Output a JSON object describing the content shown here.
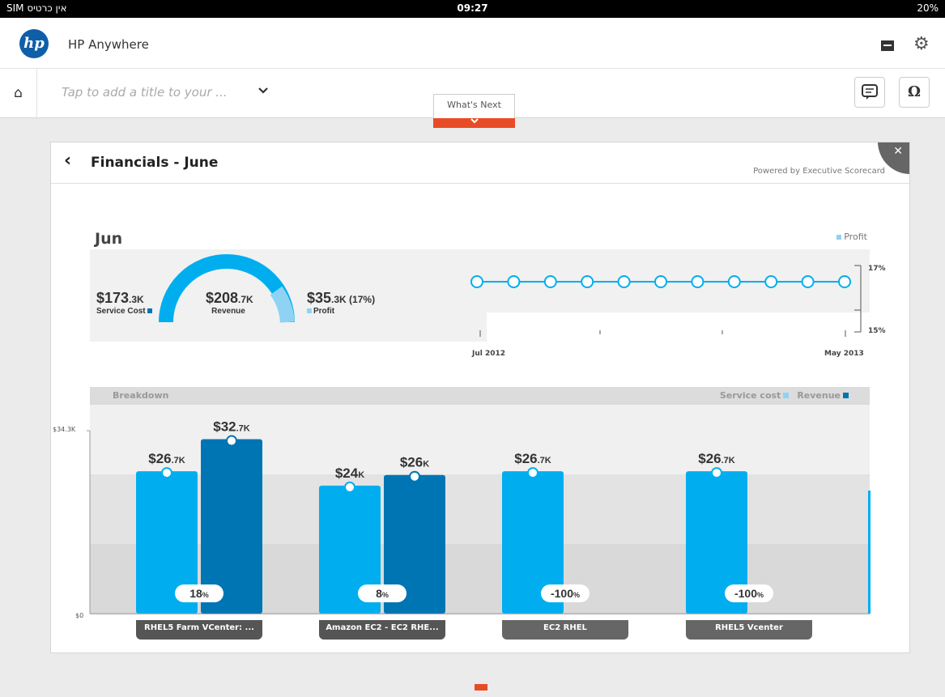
{
  "status_bar": {
    "carrier": "SIM אין כרטיס",
    "time": "09:27",
    "battery": "20%"
  },
  "app": {
    "logo_text": "hp",
    "title": "HP Anywhere"
  },
  "toolbar": {
    "title_placeholder": "Tap to add a title to your ...",
    "whats_next": "What's Next"
  },
  "card": {
    "title": "Financials - June",
    "powered_by": "Powered by Executive Scorecard",
    "close": "✕",
    "month": "Jun",
    "legend_profit": "Profit",
    "kpis": {
      "service_cost": {
        "amount": "$173",
        "unit": ".3K",
        "label": "Service Cost"
      },
      "revenue": {
        "amount": "$208",
        "unit": ".7K",
        "label": "Revenue"
      },
      "profit": {
        "amount": "$35",
        "unit": ".3K (17%)",
        "label": "Profit"
      }
    },
    "trend": {
      "y_top": "17%",
      "y_bottom": "15%",
      "x_start": "Jul 2012",
      "x_end": "May 2013",
      "points": 11
    },
    "breakdown": {
      "label": "Breakdown",
      "legend_service_cost": "Service cost",
      "legend_revenue": "Revenue",
      "y_top": "$34.3K",
      "y_bottom": "$0",
      "groups": [
        {
          "category": "RHEL5 Farm VCenter: ...",
          "service_amount": "$26",
          "service_unit": ".7K",
          "revenue_amount": "$32",
          "revenue_unit": ".7K",
          "percent": "18",
          "selected": true
        },
        {
          "category": "Amazon EC2 - EC2 RHE...",
          "service_amount": "$24",
          "service_unit": "K",
          "revenue_amount": "$26",
          "revenue_unit": "K",
          "percent": "8",
          "selected": true
        },
        {
          "category": "EC2 RHEL",
          "service_amount": "$26",
          "service_unit": ".7K",
          "revenue_amount": null,
          "revenue_unit": null,
          "percent": "-100",
          "selected": false
        },
        {
          "category": "RHEL5 Vcenter",
          "service_amount": "$26",
          "service_unit": ".7K",
          "revenue_amount": null,
          "revenue_unit": null,
          "percent": "-100",
          "selected": false
        }
      ]
    }
  },
  "chart_data": [
    {
      "type": "line",
      "title": "",
      "series": [
        {
          "name": "Profit",
          "values": [
            17,
            17,
            17,
            17,
            17,
            17,
            17,
            17,
            17,
            17,
            17
          ]
        }
      ],
      "x_range": [
        "Jul 2012",
        "May 2013"
      ],
      "ylim": [
        15,
        17
      ],
      "ylabel": "",
      "grid": false,
      "legend": "top-right"
    },
    {
      "type": "bar",
      "title": "Breakdown",
      "categories": [
        "RHEL5 Farm VCenter: ...",
        "Amazon EC2 - EC2 RHE...",
        "EC2 RHEL",
        "RHEL5 Vcenter"
      ],
      "series": [
        {
          "name": "Service cost",
          "values": [
            26.7,
            24,
            26.7,
            26.7
          ]
        },
        {
          "name": "Revenue",
          "values": [
            32.7,
            26,
            0,
            0
          ]
        }
      ],
      "percent_labels": [
        "18%",
        "8%",
        "-100%",
        "-100%"
      ],
      "ylim": [
        0,
        34.3
      ],
      "ylabel": "",
      "legend": "top-right",
      "colors": {
        "service_cost": "#00aeef",
        "revenue": "#0075b4"
      }
    }
  ],
  "colors": {
    "accent": "#e84c26",
    "service_cost": "#00aeef",
    "revenue": "#0075b4",
    "profit": "#8ed3f4"
  }
}
